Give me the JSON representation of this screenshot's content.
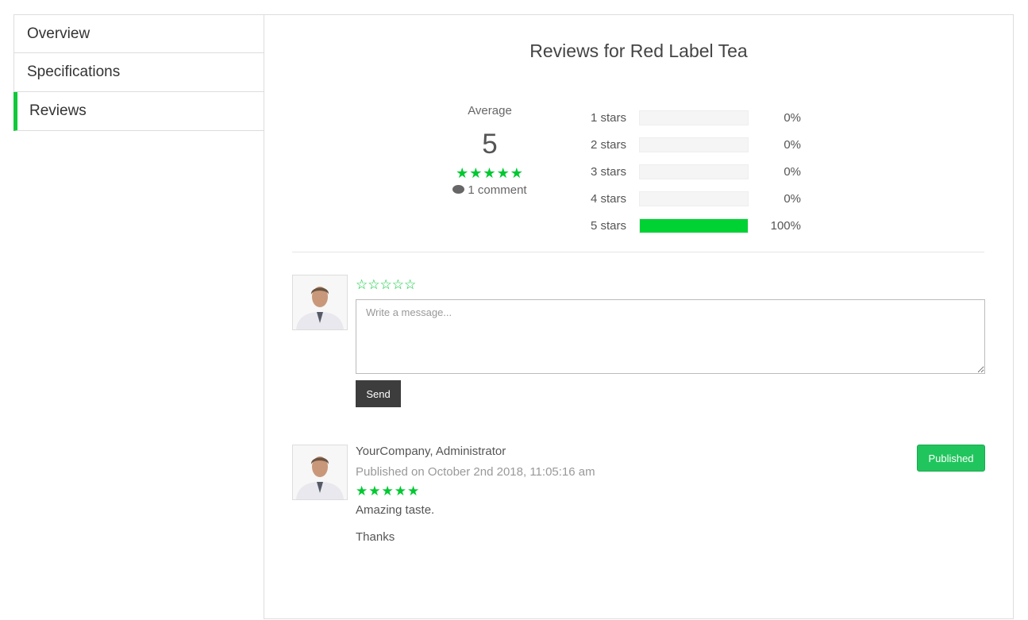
{
  "tabs": [
    {
      "label": "Overview"
    },
    {
      "label": "Specifications"
    },
    {
      "label": "Reviews"
    }
  ],
  "main": {
    "title": "Reviews for Red Label Tea",
    "average": {
      "label": "Average",
      "value": "5",
      "stars": "★★★★★",
      "comments": "1 comment"
    },
    "breakdown": [
      {
        "label": "1 stars",
        "percent": "0%",
        "fraction": 0
      },
      {
        "label": "2 stars",
        "percent": "0%",
        "fraction": 0
      },
      {
        "label": "3 stars",
        "percent": "0%",
        "fraction": 0
      },
      {
        "label": "4 stars",
        "percent": "0%",
        "fraction": 0
      },
      {
        "label": "5 stars",
        "percent": "100%",
        "fraction": 1
      }
    ]
  },
  "compose": {
    "stars": [
      "☆",
      "☆",
      "☆",
      "☆",
      "☆"
    ],
    "placeholder": "Write a message...",
    "send_label": "Send"
  },
  "review": {
    "author": "YourCompany, Administrator",
    "date": "Published on October 2nd 2018, 11:05:16 am",
    "stars": "★★★★★",
    "line1": "Amazing taste.",
    "line2": "Thanks",
    "status": "Published"
  },
  "colors": {
    "accent": "#00c832",
    "bar_fill": "#00d234",
    "published_button": "#21c55d",
    "send_button": "#3d3d3d"
  },
  "icons": {
    "comment": "comments-icon",
    "avatar": "user-avatar"
  }
}
